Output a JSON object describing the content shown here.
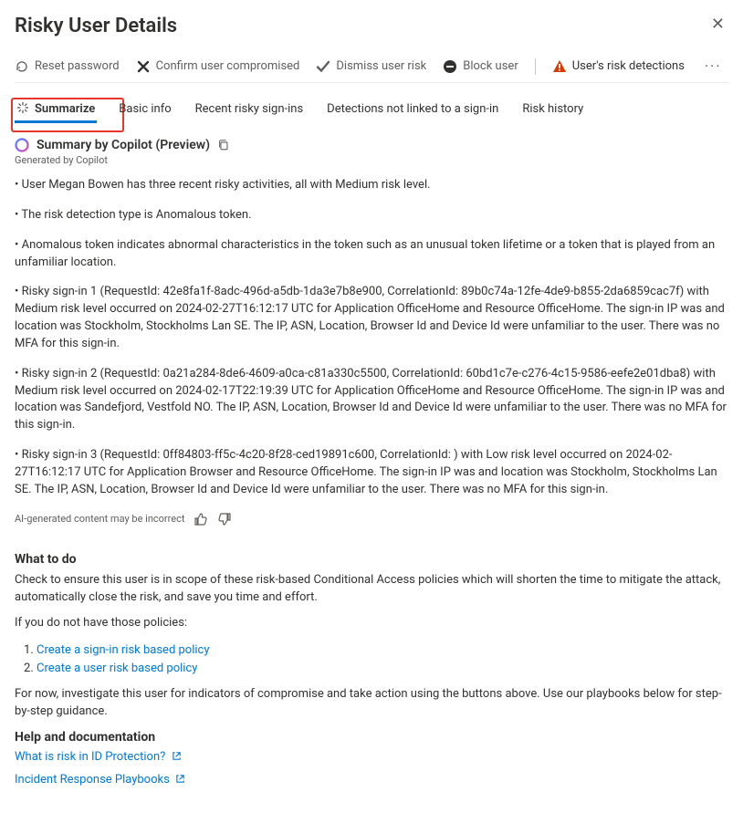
{
  "header": {
    "title": "Risky User Details"
  },
  "toolbar": {
    "reset": "Reset password",
    "confirm": "Confirm user compromised",
    "dismiss": "Dismiss user risk",
    "block": "Block user",
    "detections": "User's risk detections"
  },
  "tabs": {
    "summarize": "Summarize",
    "basic": "Basic info",
    "recent": "Recent risky sign-ins",
    "notlinked": "Detections not linked to a sign-in",
    "history": "Risk history"
  },
  "summary": {
    "title": "Summary by Copilot (Preview)",
    "generated_by": "Generated by Copilot",
    "bullets": {
      "b1": "• User Megan Bowen has three recent risky activities, all with Medium risk level.",
      "b2": "• The risk detection type is Anomalous token.",
      "b3": "• Anomalous token indicates abnormal characteristics in the token such as an unusual token lifetime or a token that is played from an unfamiliar location.",
      "b4": "• Risky sign-in 1 (RequestId: 42e8fa1f-8adc-496d-a5db-1da3e7b8e900, CorrelationId: 89b0c74a-12fe-4de9-b855-2da6859cac7f) with Medium risk level occurred on 2024-02-27T16:12:17 UTC for Application OfficeHome and Resource OfficeHome. The sign-in IP was                         and location was Stockholm, Stockholms Lan SE. The IP, ASN, Location, Browser Id and Device Id were unfamiliar to the user. There was no MFA for this sign-in.",
      "b5": "• Risky sign-in 2 (RequestId: 0a21a284-8de6-4609-a0ca-c81a330c5500, CorrelationId: 60bd1c7e-c276-4c15-9586-eefe2e01dba8) with Medium risk level occurred on 2024-02-17T22:19:39 UTC for Application OfficeHome and Resource OfficeHome. The sign-in IP was                         and location was Sandefjord, Vestfold NO. The IP, ASN, Location, Browser Id and Device Id were unfamiliar to the user. There was no MFA for this sign-in.",
      "b6": "• Risky sign-in 3 (RequestId: 0ff84803-ff5c-4c20-8f28-ced19891c600, CorrelationId: ) with Low risk level occurred on 2024-02-27T16:12:17 UTC for Application Browser and Resource OfficeHome. The sign-in IP was                                           and location was Stockholm, Stockholms Lan SE. The IP, ASN, Location, Browser Id and Device Id were unfamiliar to the user. There was no MFA for this sign-in."
    },
    "disclaimer": "AI-generated content may be incorrect"
  },
  "what_to_do": {
    "heading": "What to do",
    "p1": "Check to ensure this user is in scope of these risk-based Conditional Access policies which will shorten the time to mitigate the attack, automatically close the risk, and save you time and effort.",
    "p2": "If you do not have those policies:",
    "policy1": "Create a sign-in risk based policy",
    "policy2": "Create a user risk based policy",
    "p3": "For now, investigate this user for indicators of compromise and take action using the buttons above. Use our playbooks below for step-by-step guidance."
  },
  "help": {
    "heading": "Help and documentation",
    "link1": "What is risk in ID Protection?",
    "link2": "Incident Response Playbooks"
  }
}
